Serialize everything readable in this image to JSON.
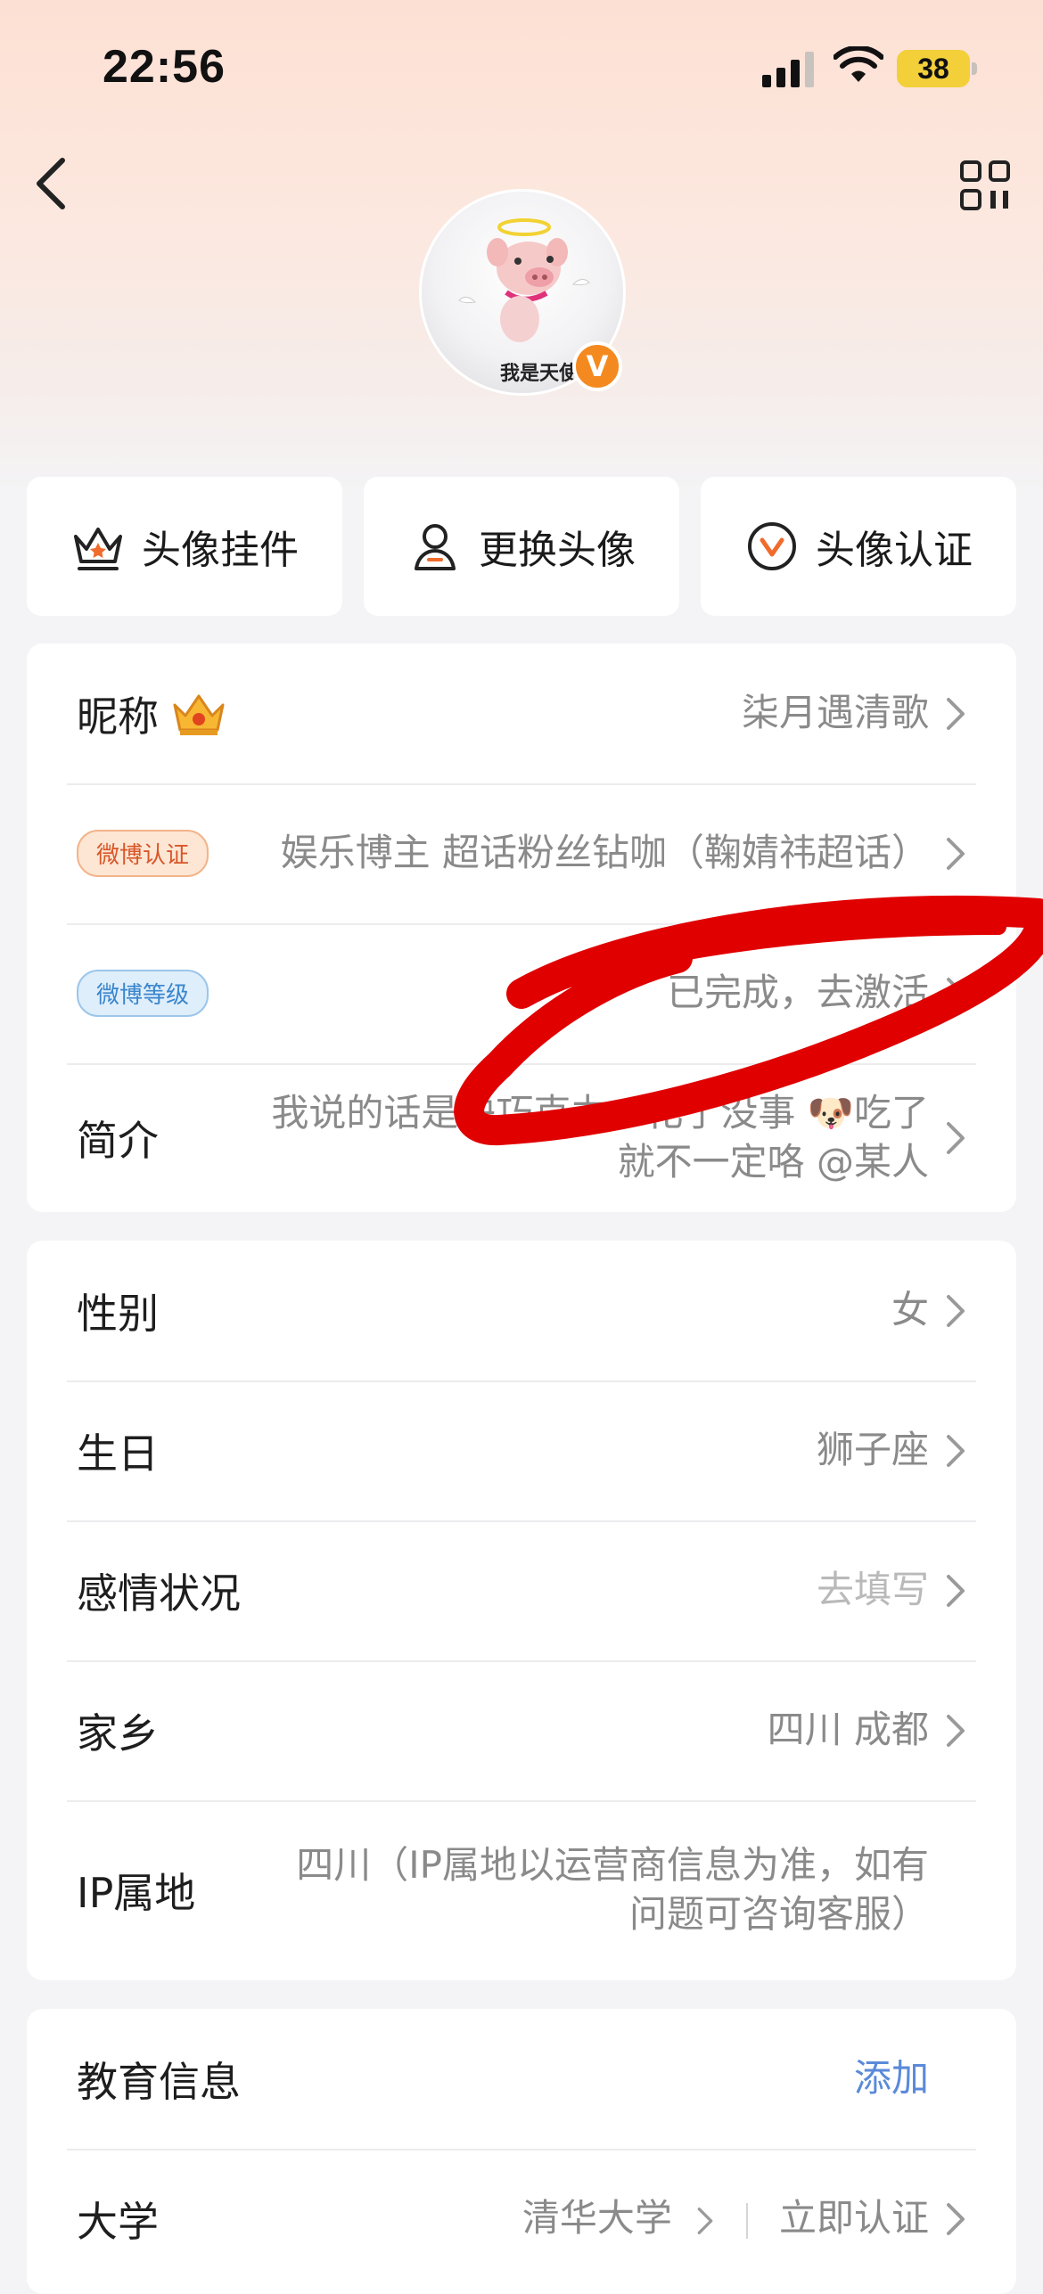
{
  "status_bar": {
    "time": "22:56",
    "battery": "38"
  },
  "avatar": {
    "caption": "我是天使",
    "verified_badge": "V"
  },
  "actions": [
    {
      "label": "头像挂件",
      "icon": "crown-icon"
    },
    {
      "label": "更换头像",
      "icon": "person-icon"
    },
    {
      "label": "头像认证",
      "icon": "v-badge-icon"
    }
  ],
  "basic": {
    "nickname_label": "昵称",
    "nickname_value": "柒月遇清歌",
    "cert_tag": "微博认证",
    "cert_value": "娱乐博主 超话粉丝钻咖（鞠婧祎超话）",
    "level_tag": "微博等级",
    "level_value": "已完成，去激活",
    "bio_label": "简介",
    "bio_line1": "我说的话是块巧克力，化了没事 🐶吃了",
    "bio_line2": "就不一定咯 @某人"
  },
  "details": {
    "gender_label": "性别",
    "gender_value": "女",
    "birthday_label": "生日",
    "birthday_value": "狮子座",
    "relationship_label": "感情状况",
    "relationship_value": "去填写",
    "hometown_label": "家乡",
    "hometown_value": "四川 成都",
    "ip_label": "IP属地",
    "ip_line1": "四川（IP属地以运营商信息为准，如有",
    "ip_line2": "问题可咨询客服）"
  },
  "education": {
    "title": "教育信息",
    "add_label": "添加",
    "university_label": "大学",
    "university_value": "清华大学",
    "verify_label": "立即认证"
  },
  "colors": {
    "accent_orange": "#f48a1f",
    "link_blue": "#5b8ad9",
    "scribble_red": "#e00000"
  }
}
